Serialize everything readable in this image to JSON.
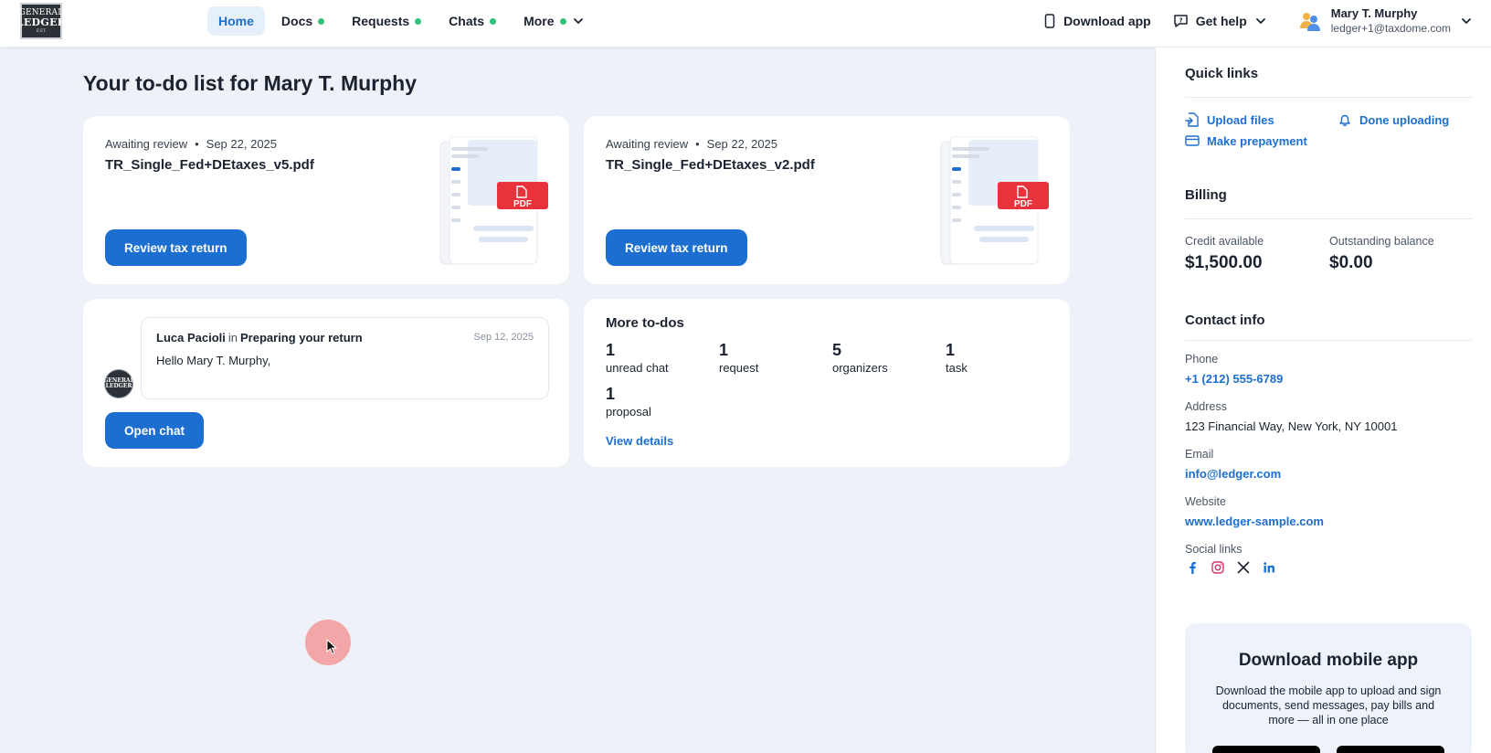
{
  "logo": {
    "line1": "GENERAL",
    "line2": "LEDGER",
    "line3": "EST"
  },
  "nav": {
    "items": [
      {
        "label": "Home",
        "active": true,
        "dot": false
      },
      {
        "label": "Docs",
        "active": false,
        "dot": true
      },
      {
        "label": "Requests",
        "active": false,
        "dot": true
      },
      {
        "label": "Chats",
        "active": false,
        "dot": true
      },
      {
        "label": "More",
        "active": false,
        "dot": true
      }
    ]
  },
  "header": {
    "download_app": "Download app",
    "get_help": "Get help",
    "user_name": "Mary T. Murphy",
    "user_email": "ledger+1@taxdome.com"
  },
  "main": {
    "title": "Your to-do list for Mary T. Murphy",
    "docs": [
      {
        "status": "Awaiting review",
        "date": "Sep 22, 2025",
        "name": "TR_Single_Fed+DEtaxes_v5.pdf",
        "button": "Review tax return",
        "badge": "PDF"
      },
      {
        "status": "Awaiting review",
        "date": "Sep 22, 2025",
        "name": "TR_Single_Fed+DEtaxes_v2.pdf",
        "button": "Review tax return",
        "badge": "PDF"
      }
    ],
    "chat": {
      "sender": "Luca Pacioli",
      "in": "in",
      "thread": "Preparing your return",
      "date": "Sep 12, 2025",
      "message": "Hello Mary T. Murphy,",
      "button": "Open chat",
      "avatar_text": "GENERAL LEDGER"
    },
    "more": {
      "title": "More to-dos",
      "items": [
        {
          "count": "1",
          "label": "unread chat"
        },
        {
          "count": "1",
          "label": "request"
        },
        {
          "count": "5",
          "label": "organizers"
        },
        {
          "count": "1",
          "label": "task"
        },
        {
          "count": "1",
          "label": "proposal"
        }
      ],
      "view_details": "View details"
    }
  },
  "side": {
    "quick_links_title": "Quick links",
    "quick_links": {
      "upload": "Upload files",
      "done": "Done uploading",
      "prepay": "Make prepayment"
    },
    "billing_title": "Billing",
    "credit_label": "Credit available",
    "credit_value": "$1,500.00",
    "balance_label": "Outstanding balance",
    "balance_value": "$0.00",
    "contact_title": "Contact info",
    "phone_label": "Phone",
    "phone": "+1 (212) 555-6789",
    "address_label": "Address",
    "address": "123 Financial Way, New York, NY 10001",
    "email_label": "Email",
    "email": "info@ledger.com",
    "website_label": "Website",
    "website": "www.ledger-sample.com",
    "social_label": "Social links",
    "social_icons": [
      "facebook-icon",
      "instagram-icon",
      "x-icon",
      "linkedin-icon"
    ],
    "promo_title": "Download mobile app",
    "promo_text": "Download the mobile app to upload and sign documents, send messages, pay bills and more — all in one place"
  },
  "colors": {
    "accent": "#1c6fd1",
    "dot": "#2fc27a",
    "pdf": "#e8333d",
    "bg": "#eef1f7"
  }
}
